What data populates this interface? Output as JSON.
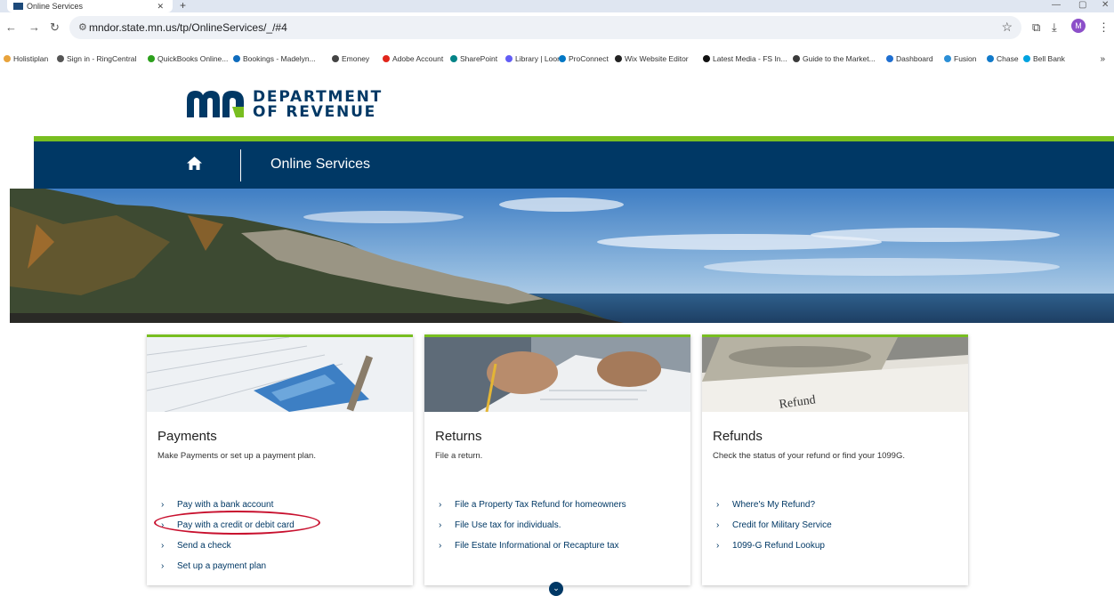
{
  "browser": {
    "tab_title": "Online Services",
    "url": "mndor.state.mn.us/tp/OnlineServices/_/#4",
    "avatar_initial": "M",
    "bookmarks": [
      {
        "label": "Holistiplan",
        "color": "#e8a33c"
      },
      {
        "label": "Sign in - RingCentral",
        "color": "#555555"
      },
      {
        "label": "QuickBooks Online...",
        "color": "#2ca01c"
      },
      {
        "label": "Bookings - Madelyn...",
        "color": "#0f6cbd"
      },
      {
        "label": "Emoney",
        "color": "#444444"
      },
      {
        "label": "Adobe Account",
        "color": "#e1251b"
      },
      {
        "label": "SharePoint",
        "color": "#038387"
      },
      {
        "label": "Library | Loom",
        "color": "#625df5"
      },
      {
        "label": "ProConnect",
        "color": "#0077c5"
      },
      {
        "label": "Wix Website Editor",
        "color": "#222222"
      },
      {
        "label": "Latest Media - FS In...",
        "color": "#111111"
      },
      {
        "label": "Guide to the Market...",
        "color": "#3b3b3b"
      },
      {
        "label": "Dashboard",
        "color": "#1f6fd1"
      },
      {
        "label": "Fusion",
        "color": "#2c8fd6"
      },
      {
        "label": "Chase",
        "color": "#117aca"
      },
      {
        "label": "Bell Bank",
        "color": "#00a3e0"
      }
    ],
    "bookmarks_more": "»"
  },
  "header": {
    "logo_line1": "DEPARTMENT",
    "logo_line2": "OF REVENUE",
    "nav_title": "Online Services"
  },
  "cards": [
    {
      "title": "Payments",
      "description": "Make Payments or set up a payment plan.",
      "links": [
        "Pay with a bank account",
        "Pay with a credit or debit card",
        "Send a check",
        "Set up a payment plan"
      ]
    },
    {
      "title": "Returns",
      "description": "File a return.",
      "links": [
        "File a Property Tax Refund for homeowners",
        "File Use tax for individuals.",
        "File Estate Informational or Recapture tax"
      ]
    },
    {
      "title": "Refunds",
      "description": "Check the status of your refund or find your 1099G.",
      "links": [
        "Where's My Refund?",
        "Credit for Military Service",
        "1099-G Refund Lookup"
      ]
    }
  ],
  "colors": {
    "brand_blue": "#003865",
    "brand_green": "#78be20",
    "highlight_red": "#c8102e"
  }
}
